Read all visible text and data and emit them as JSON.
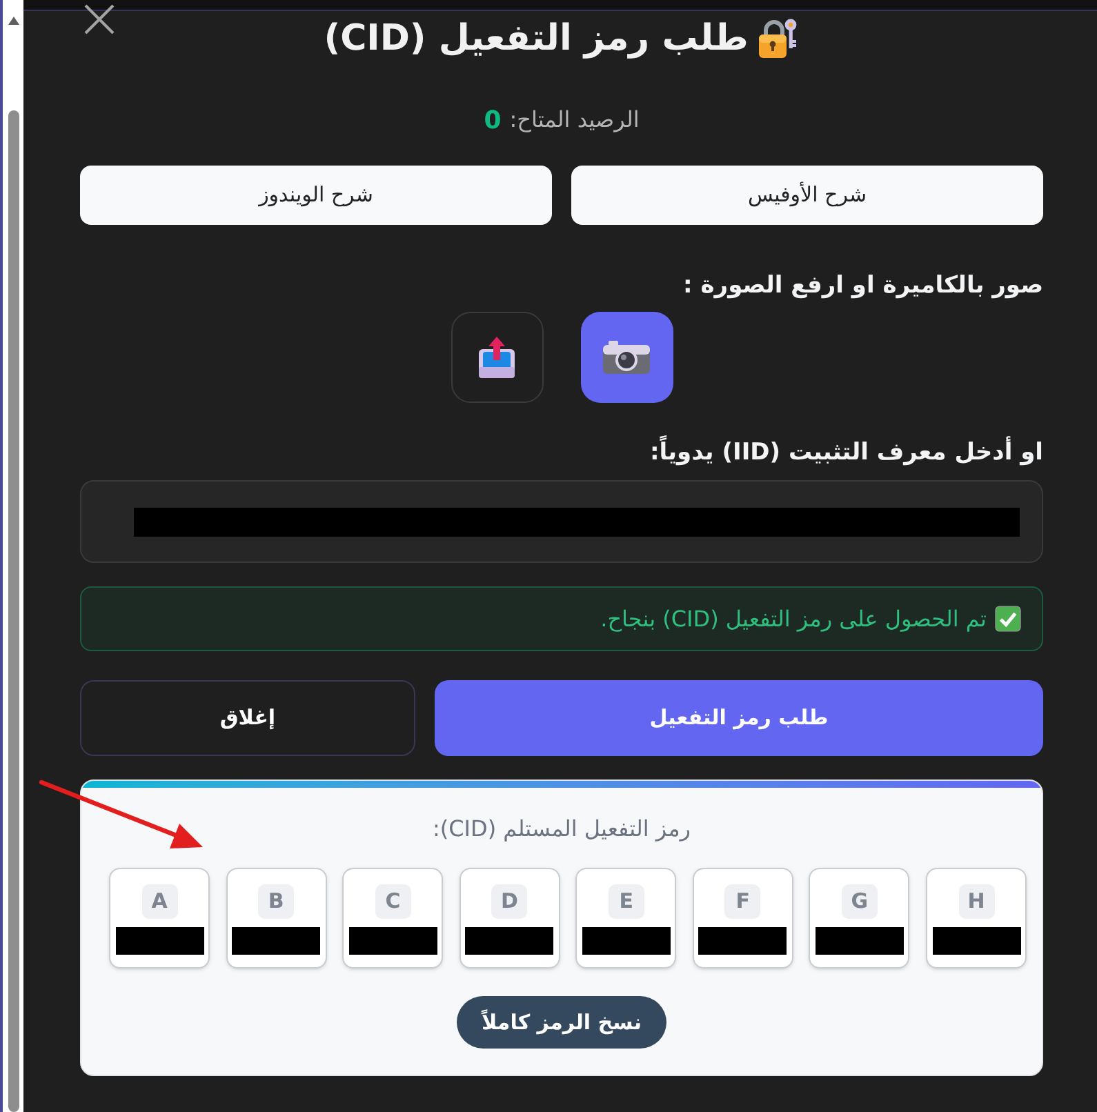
{
  "dialog": {
    "title": "طلب رمز التفعيل (CID)"
  },
  "balance": {
    "label": "الرصيد المتاح:",
    "value": "0"
  },
  "guide_buttons": [
    "شرح الأوفيس",
    "شرح الويندوز"
  ],
  "capture": {
    "label": "صور بالكاميرة او ارفع الصورة :",
    "options": [
      {
        "kind": "camera",
        "selected": true
      },
      {
        "kind": "upload",
        "selected": false
      }
    ]
  },
  "iid": {
    "label": "او أدخل معرف التثبيت (IID) يدوياً:",
    "value_redacted": true
  },
  "alert": {
    "kind": "success",
    "message": "تم الحصول على رمز التفعيل (CID) بنجاح."
  },
  "actions": [
    {
      "kind": "primary",
      "label": "طلب رمز التفعيل"
    },
    {
      "kind": "secondary",
      "label": "إغلاق"
    }
  ],
  "result": {
    "label": "رمز التفعيل المستلم (CID):",
    "groups": [
      {
        "letter": "H",
        "value_redacted": true
      },
      {
        "letter": "G",
        "value_redacted": true
      },
      {
        "letter": "F",
        "value_redacted": true
      },
      {
        "letter": "E",
        "value_redacted": true
      },
      {
        "letter": "D",
        "value_redacted": true
      },
      {
        "letter": "C",
        "value_redacted": true
      },
      {
        "letter": "B",
        "value_redacted": true
      },
      {
        "letter": "A",
        "value_redacted": true
      }
    ],
    "copy_button": "نسخ الرمز كاملاً"
  },
  "annotations": [
    {
      "kind": "arrow"
    }
  ]
}
